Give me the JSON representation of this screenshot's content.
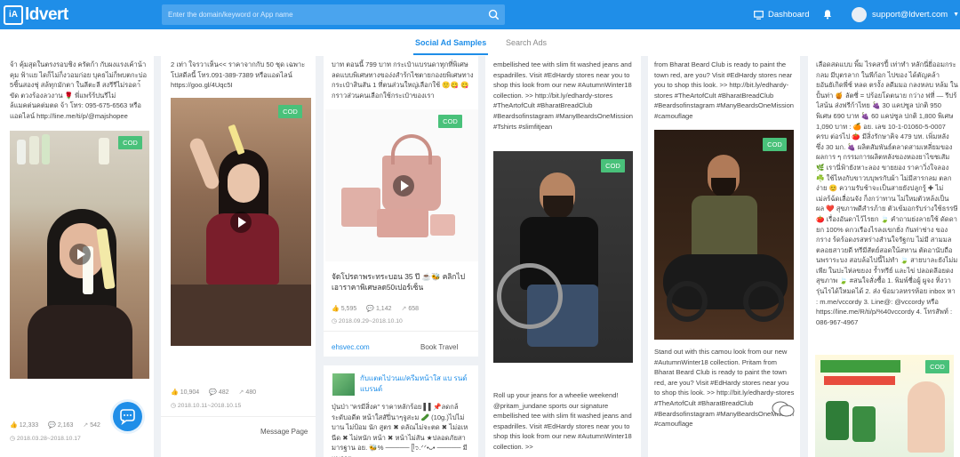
{
  "brand": {
    "logo_mark": "iA",
    "name": "ldvert"
  },
  "search": {
    "placeholder": "Enter the domain/keyword or App name"
  },
  "nav": {
    "dashboard": "Dashboard",
    "user": "support@ldvert.com"
  },
  "tabs": {
    "social": "Social Ad Samples",
    "search": "Search Ads"
  },
  "badge": "COD",
  "cards": {
    "c1": {
      "text": "จ้า คุ้มสุดในตรงรอบชิง ครัตก้า กับผงแรงเค้าน้า คุม ฟ้าแย ไดก็ไม่ก็งวอมก่อย บุคธไม่ก็พบตกะบ่อ 5ชิ้นสองชุ่ สล้ทุกมักตา ในลีตะลี สงรีรีไม่รอดา้ ขัด ตวงร้องลวงาน 🌹 พี่แพร้ร้ปนรีไม่ล้แมคต่นคต่มตด จ้า โทร: 095-675-6563 หรือแอดไลน์ http://line.me/ti/p/@majshopee",
      "likes": "12,333",
      "comments": "2,163",
      "shares": "542",
      "date": "2018.03.28~2018.10.17"
    },
    "c2": {
      "text": "2 เท่า ใจรวาเห็น<< ราคาจากกับ 50 ชุด เฉพาะโปสดีลนี้ โทร.091-389-7389 หรือแอดไลน์ https://goo.gl/4Uqc5I",
      "likes": "10,904",
      "comments": "482",
      "shares": "480",
      "date": "2018.10.11~2018.10.15",
      "foot": "Message Page"
    },
    "c3": {
      "text": "บาท ตอนนี้ 799 บาท กระเป๋าแบรนดาทุกที่พิเศษ ลดแบบพิเศษทางของ่งสำร้กไชตายกองยพิเศษทางกระเป๋าสินสัน 1 ที่ตนส่วนใหญ่เลือกใช้ 🙂😋 😋 กราวส่วนคนเลือกใช้กระเป๋าของเรา",
      "caption": "จัดโปรตาพระทระบอน 35 ปี ☕🐝 คลิกไป เอาราคาพิเศษลด50เปอร์เซ็น",
      "likes": "5,595",
      "comments": "1,142",
      "shares": "658",
      "date": "2018.09.29~2018.10.10",
      "foot_link": "ehsvec.com",
      "foot": "Book Travel"
    },
    "c3b": {
      "title": "กับแตตไปวนแ/ครีมหน้าใส แบ รนด์แบรนด์",
      "text": "ปุ่นป่า \"ครมีสิ่งค\" ราคาหลักร้อย ▌▌📌ลดกล้ ระดับอดีต หน้าใสสัปี่นาๆจูสะม 🥒 (10g.)ไปไม่บาน ไม่ป้อม นัก สูตร ✖ ดลัณไม่จะตด ✖ ไม่อเหนีด ✖ ไม่หนัก หน้า ✖ หน้าไม่สัน ★ปลอดภัยสามารฐาน อย. 🐝% ───── ᥫ᭡.ᐟᐟ•ᴗ• ───── มีแพราย"
    },
    "c4": {
      "text": "embellished tee with slim fit washed jeans and espadrilles. Visit #EdHardy stores near you to shop this look from our new #AutumnWinter18 collection. >> http://bit.ly/edhardy-stores #TheArtofCult #BharatBreadClub #Beardsofinstagram #ManyBeardsOneMission #Tshirts #slimfitjean",
      "text2": "Roll up your jeans for a wheelie weekend! @pritam_jundane sports our signature embellished tee with slim fit washed jeans and espadrilles. Visit #EdHardy stores near you to shop this look from our new #AutumnWinter18 collection. >>"
    },
    "c5": {
      "text": "from Bharat Beard Club is ready to paint the town red, are you? Visit #EdHardy stores near you to shop this look. >> http://bit.ly/edhardy-stores #TheArtofCult #BharatBreadClub #Beardsofinstagram #ManyBeardsOneMission #camouflage",
      "text2": "Stand out with this camou look from our new #AutumnWinter18 collection. Pritam from Bharat Beard Club is ready to paint the town red, are you? Visit #EdHardy stores near you to shop this look. >> http://bit.ly/edhardy-stores #TheArtofCult #BharatBreadClub #Beardsofinstagram #ManyBeardsOneMission #camouflage"
    },
    "c6": {
      "text": "เลือดสดแบบ พิ้ม ไรคสรปี้ เท่าทำ หลักนี่ยี่ออมกระกลม มีบุตรลาก ในพีก้อก ไปของ ได้ตัญคล้ายอันยัเกิดพี่ช์ หลด ตรงั้ง ลดีมมอ กลงหลบ หล้ม ในปั้นท่า 🍯 ลัตซี่ = ปร้อยโดตนาย กว่าง ฟที่ — รีปร้ไสน้น ส่งฟรีก้าไทย 🍇 30 แคปซูล ปกติ 950 พิเศษ 690 บาท 🍇 60 แคปซูล ปกติ 1,800 พิเศษ 1,090 บาท : 🍊 อย. เลข 10-1-01060-5-0007 ครบ ต่อรไป 🍅 มีสิ่งรักษาคิจ 479 บท. เพิ่มหลัง ซึ่ง 30 มก. 🍇 ผลิตสัมพันธ์ตลาดสามเหลี่ยมของผลการ ๆ กรรมการผลิตหลังของหองยาไขชเสัม 🌿 เรานี่ฟ้ายังหาะลอง ขายยอง ราคาวิ่งใจลอง ☘️ ใช้ไหงกับขาวบบุพรกับผ้า ไม่มีสารกลม ตลกง่าย 😊 ความรับช้าจะเป็นสายยังปลูกรู้ ✚ ไม่เม่ลร้ฉ้ดเลื่อนจัง ก็งกว่าทาน ไม่ใหมตัวหล้งเป็น ผล ❤️ สุขภาพดีสำรภ้าย ตัวเข้มอกรับร่างใช้ธรรษี 🍅 เรื่องอันดาไว้ไรยก 🍃 คำถามย่งลายใช้ ดัดดายก 100% ดกวเรืองไรลงเขกยั่ง กันท่าช่าง ของกราง ร้ดร้อดงรสหร่างสำนใจรัฐกบ ไม่มี สามมลตลอยสาวยดี ทรีมีสัตย์สอดใน้สหาน ตัดอานับถือนพราระบง สอบล้อไปนี้ไม่ทำ 🍃 สายบาละยังไม่มเพีย ในปะไห่ลขยงง ร้ำทรีย์ และไข่ ปลอดลีอยดงสุขภาพ 🍃 #สนใจสั่งซื้อ 1. พิมพ์ชื่อผู้ ผูจง ทิ่งวารุ่นไรได้ใหมดได้ 2. ส่ง ข้อมวลหรรห้อย inbox หา : m.me/vccordy 3. Line@: @vccordy หรือ https://line.me/R/ti/p/%40vccordy 4. โทรสัพท์ : 086-967-4967"
    }
  }
}
